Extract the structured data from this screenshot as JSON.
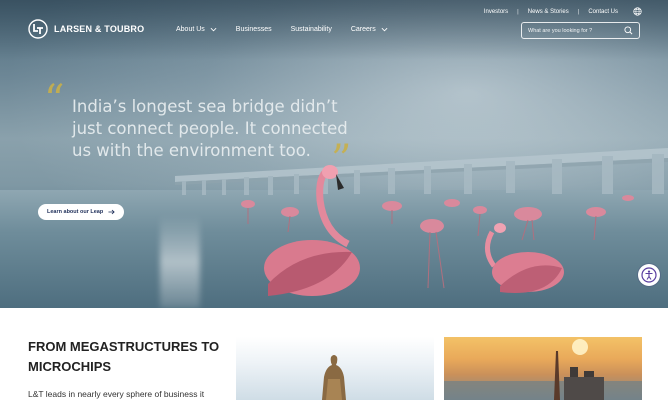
{
  "brand": {
    "name": "LARSEN & TOUBRO"
  },
  "utility_nav": {
    "items": [
      "Investors",
      "News & Stories",
      "Contact Us"
    ]
  },
  "main_nav": {
    "items": [
      {
        "label": "About Us",
        "has_dropdown": true
      },
      {
        "label": "Businesses",
        "has_dropdown": false
      },
      {
        "label": "Sustainability",
        "has_dropdown": false
      },
      {
        "label": "Careers",
        "has_dropdown": true
      }
    ]
  },
  "search": {
    "placeholder": "What are you looking for ?"
  },
  "hero": {
    "headline_lines": [
      "India’s longest sea bridge didn’t",
      "just connect people. It connected",
      "us with the environment too."
    ],
    "cta_label": "Learn about our Leap"
  },
  "section": {
    "title_lines": [
      "FROM MEGASTRUCTURES TO",
      "MICROCHIPS"
    ],
    "text": "L&T leads in nearly every sphere of business it"
  },
  "colors": {
    "quote_mark": "#c8b04a",
    "cta_text": "#1f2f5a",
    "accessibility": "#5a3fa0"
  },
  "icons": [
    "lt-logo-icon",
    "globe-icon",
    "chevron-down-icon",
    "search-icon",
    "arrow-right-icon",
    "accessibility-icon"
  ]
}
